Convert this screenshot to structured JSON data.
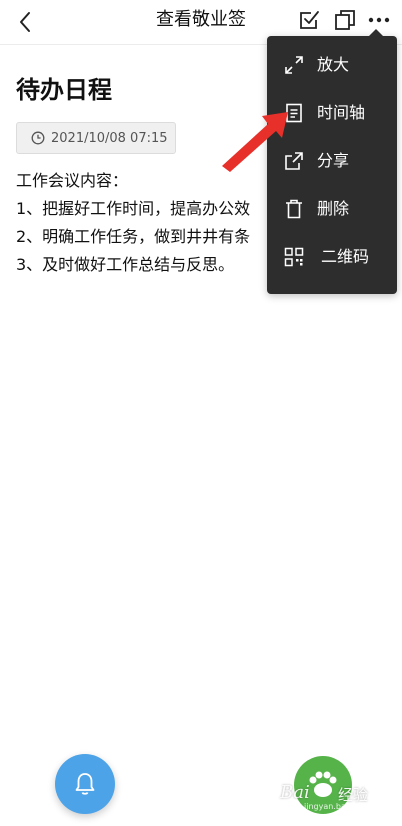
{
  "header": {
    "title": "查看敬业签",
    "back_icon": "chevron-left-icon",
    "checkbox_icon": "checkbox-edit-icon",
    "copy_icon": "copy-icon",
    "more_icon": "more-dots-icon"
  },
  "note": {
    "title": "待办日程",
    "timestamp": "2021/10/08 07:15",
    "lines": [
      "工作会议内容：",
      "1、把握好工作时间，提高办公效",
      "2、明确工作任务，做到井井有条",
      "3、及时做好工作总结与反思。"
    ]
  },
  "menu": {
    "items": [
      {
        "label": "放大",
        "icon": "expand-icon"
      },
      {
        "label": "时间轴",
        "icon": "document-icon"
      },
      {
        "label": "分享",
        "icon": "share-icon"
      },
      {
        "label": "删除",
        "icon": "trash-icon"
      },
      {
        "label": "二维码",
        "icon": "qrcode-icon"
      }
    ]
  },
  "fab": {
    "bell_icon": "bell-icon"
  },
  "colors": {
    "menu_bg": "#2d2d2d",
    "fab_blue": "#4da3e8",
    "fab_green": "#56b34a",
    "arrow_red": "#e8302a"
  },
  "watermark": {
    "brand": "Bai",
    "sub": "经验",
    "url": "jingyan.baidu.com"
  }
}
